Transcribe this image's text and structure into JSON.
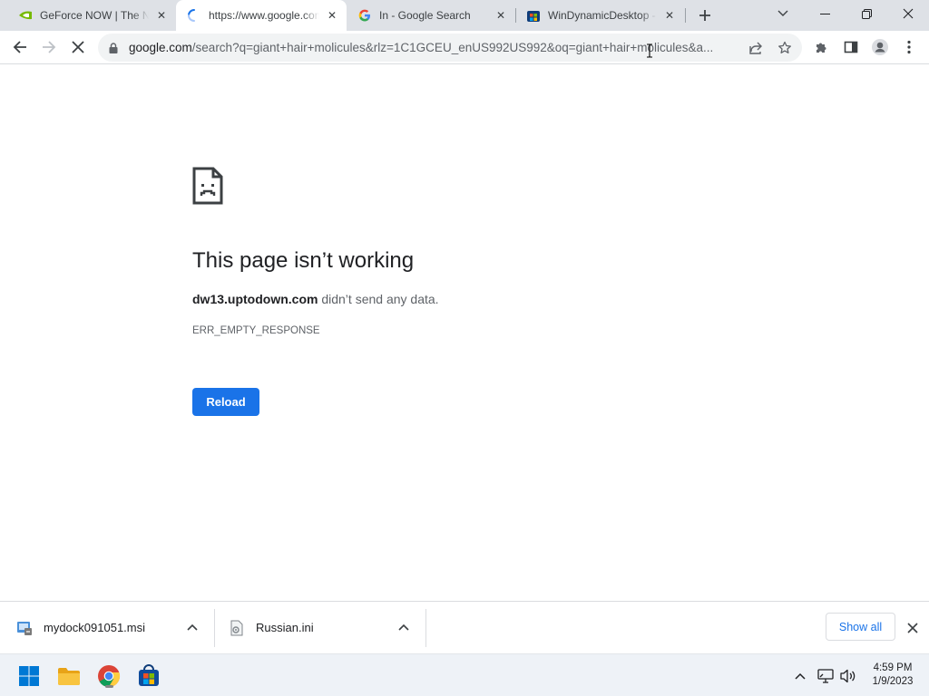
{
  "tabs": [
    {
      "title": "GeForce NOW | The New",
      "favicon": "nvidia-icon",
      "active": false
    },
    {
      "title": "https://www.google.com/search",
      "favicon": "loading-spinner-icon",
      "active": true
    },
    {
      "title": "In - Google Search",
      "favicon": "google-g-icon",
      "active": false
    },
    {
      "title": "WinDynamicDesktop - Microsoft Store",
      "favicon": "ms-store-icon",
      "active": false
    }
  ],
  "address_bar": {
    "host": "google.com",
    "path": "/search?q=giant+hair+molicules&rlz=1C1GCEU_enUS992US992&oq=giant+hair+molicules&a..."
  },
  "error_page": {
    "title": "This page isn’t working",
    "host": "dw13.uptodown.com",
    "message": " didn’t send any data.",
    "code": "ERR_EMPTY_RESPONSE",
    "reload_label": "Reload"
  },
  "downloads": {
    "items": [
      {
        "name": "mydock091051.msi",
        "icon": "msi-installer-icon"
      },
      {
        "name": "Russian.ini",
        "icon": "ini-file-icon"
      }
    ],
    "show_all_label": "Show all"
  },
  "taskbar": {
    "apps": [
      "windows-start-icon",
      "file-explorer-icon",
      "chrome-icon",
      "microsoft-store-icon"
    ],
    "time": "4:59 PM",
    "date": "1/9/2023"
  },
  "colors": {
    "accent": "#1a73e8",
    "tabstrip_bg": "#dee1e6",
    "omnibox_bg": "#f1f3f4"
  }
}
